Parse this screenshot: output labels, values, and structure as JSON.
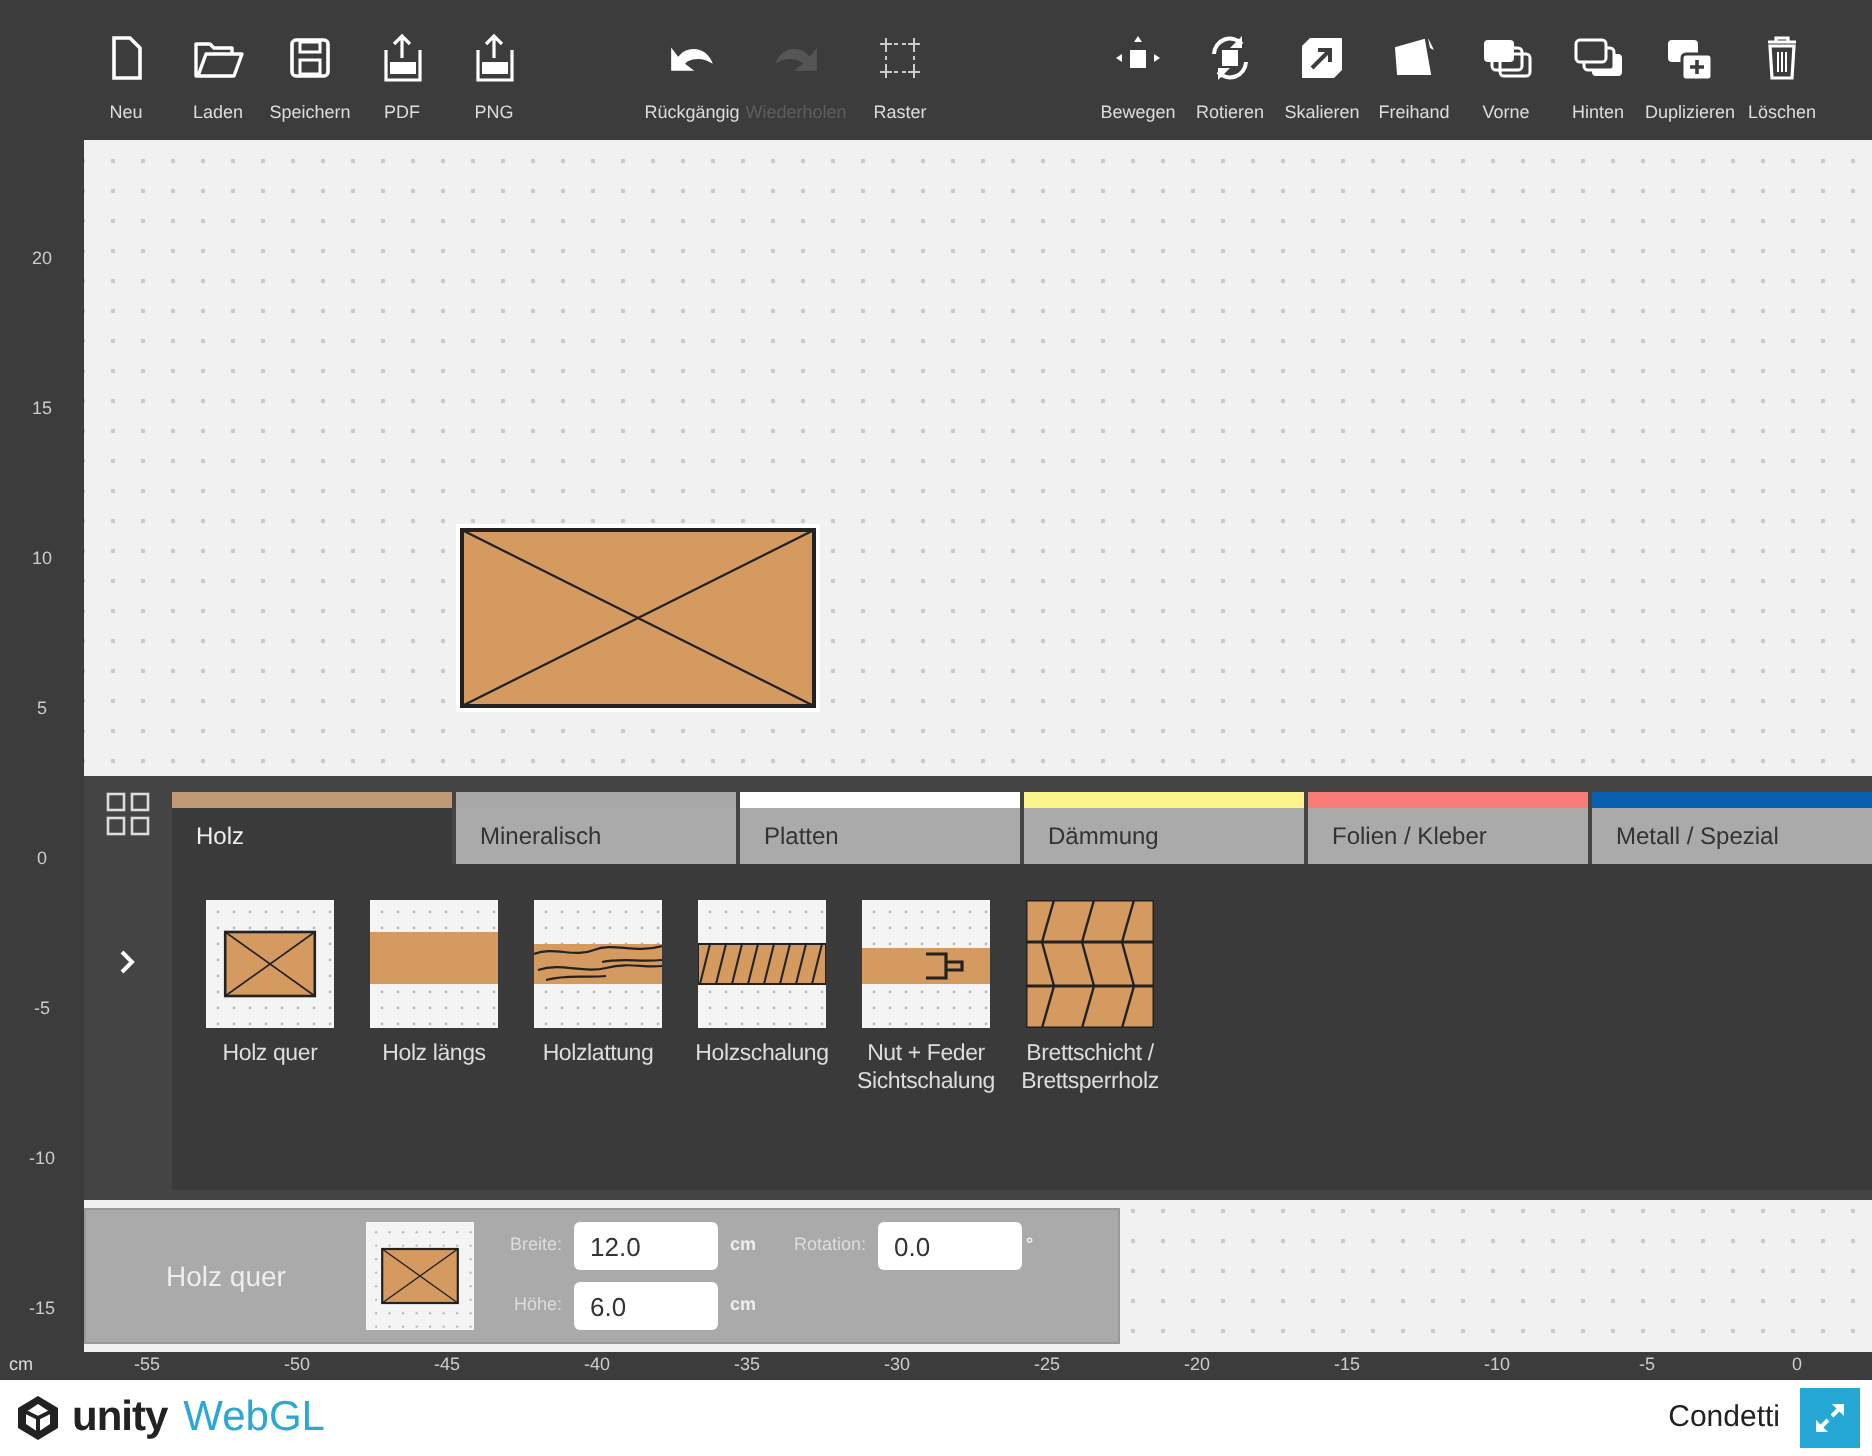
{
  "toolbar": {
    "groups": [
      {
        "items": [
          {
            "kind": "new",
            "label": "Neu",
            "disabled": false
          },
          {
            "kind": "open",
            "label": "Laden",
            "disabled": false
          },
          {
            "kind": "save",
            "label": "Speichern",
            "disabled": false
          },
          {
            "kind": "pdf",
            "label": "PDF",
            "disabled": false
          },
          {
            "kind": "png",
            "label": "PNG",
            "disabled": false
          }
        ]
      },
      {
        "items": [
          {
            "kind": "undo",
            "label": "Rückgängig",
            "disabled": false
          },
          {
            "kind": "redo",
            "label": "Wiederholen",
            "disabled": true
          },
          {
            "kind": "grid",
            "label": "Raster",
            "disabled": false
          }
        ]
      },
      {
        "items": [
          {
            "kind": "move",
            "label": "Bewegen",
            "disabled": false
          },
          {
            "kind": "rotate",
            "label": "Rotieren",
            "disabled": false
          },
          {
            "kind": "scale",
            "label": "Skalieren",
            "disabled": false
          },
          {
            "kind": "freehand",
            "label": "Freihand",
            "disabled": false
          },
          {
            "kind": "front",
            "label": "Vorne",
            "disabled": false
          },
          {
            "kind": "back",
            "label": "Hinten",
            "disabled": false
          },
          {
            "kind": "duplicate",
            "label": "Duplizieren",
            "disabled": false
          },
          {
            "kind": "delete",
            "label": "Löschen",
            "disabled": false
          }
        ]
      }
    ]
  },
  "ruler_left": {
    "labels": [
      "20",
      "15",
      "10",
      "5",
      "0",
      "-5",
      "-10",
      "-15"
    ]
  },
  "ruler_bottom": {
    "unit": "cm",
    "labels": [
      "-55",
      "-50",
      "-45",
      "-40",
      "-35",
      "-30",
      "-25",
      "-20",
      "-15",
      "-10",
      "-5",
      "0"
    ]
  },
  "canvas": {
    "shapes": [
      {
        "kind": "quer",
        "selected": true
      }
    ]
  },
  "material_panel": {
    "tabs": [
      {
        "label": "Holz",
        "color": "#c09a74",
        "selected": true
      },
      {
        "label": "Mineralisch",
        "color": "#a8a8a8",
        "selected": false
      },
      {
        "label": "Platten",
        "color": "#ffffff",
        "selected": false
      },
      {
        "label": "Dämmung",
        "color": "#fcf48c",
        "selected": false
      },
      {
        "label": "Folien / Kleber",
        "color": "#f87c78",
        "selected": false
      },
      {
        "label": "Metall / Spezial",
        "color": "#0a5eb0",
        "selected": false
      }
    ],
    "items": [
      {
        "kind": "quer",
        "label": "Holz quer"
      },
      {
        "kind": "laengs",
        "label": "Holz längs"
      },
      {
        "kind": "lattung",
        "label": "Holzlattung"
      },
      {
        "kind": "schalung",
        "label": "Holzschalung"
      },
      {
        "kind": "nutfeder",
        "label": "Nut + Feder Sichtschalung"
      },
      {
        "kind": "brettschicht",
        "label": "Brettschicht / Brettsperrholz"
      }
    ]
  },
  "properties": {
    "name": "Holz quer",
    "kind": "quer",
    "fields": [
      {
        "label": "Breite:",
        "value": "12.0",
        "unit": "cm"
      },
      {
        "label": "Rotation:",
        "value": "0.0",
        "unit": "°"
      },
      {
        "label": "Höhe:",
        "value": "6.0",
        "unit": "cm"
      }
    ]
  },
  "footer": {
    "logo": "unity",
    "product": "WebGL",
    "brand": "Condetti"
  }
}
